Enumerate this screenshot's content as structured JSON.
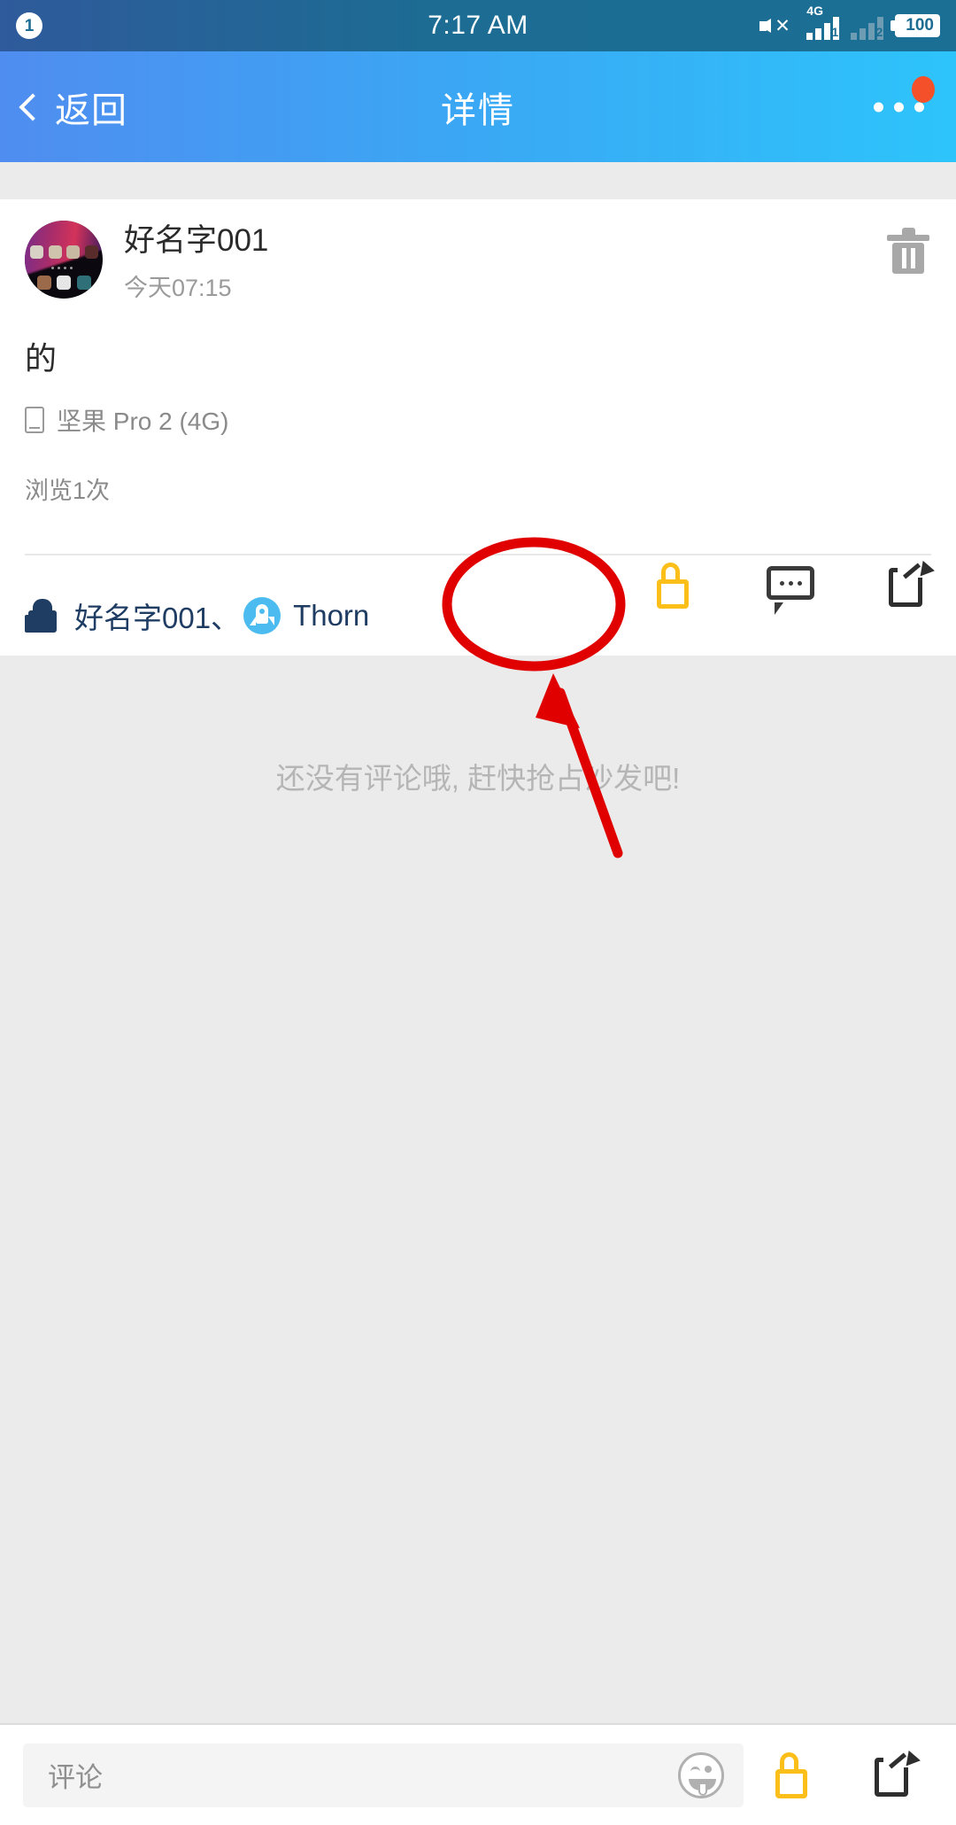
{
  "statusbar": {
    "notification_count": "1",
    "time": "7:17 AM",
    "mute_icon": "speaker-mute-icon",
    "network_label": "4G",
    "sim1_label": "1",
    "sim2_label": "2",
    "battery_level": "100"
  },
  "navbar": {
    "back_label": "返回",
    "title": "详情",
    "more_icon": "more-dots-icon",
    "has_badge": true,
    "badge_color": "#f4502a",
    "gradient_from": "#4f8df0",
    "gradient_to": "#2dc4fb"
  },
  "post": {
    "author": "好名字001",
    "time": "今天07:15",
    "content": "的",
    "device": "坚果 Pro 2 (4G)",
    "views": "浏览1次",
    "delete_icon": "trash-icon",
    "like_icon": "thumbs-up-icon",
    "comment_icon": "comment-bubble-icon",
    "share_icon": "share-icon",
    "like_icon_color": "#fcbe18"
  },
  "likes": {
    "icon": "thumbs-up-filled-icon",
    "first_user": "好名字001、",
    "second_user": "Thorn",
    "second_avatar_icon": "rocket-icon",
    "text_color": "#1f3c63",
    "avatar_color": "#4cbcf0"
  },
  "comments": {
    "empty_text": "还没有评论哦, 赶快抢占沙发吧!"
  },
  "bottombar": {
    "input_placeholder": "评论",
    "emoji_icon": "emoji-tongue-icon",
    "like_icon": "thumbs-up-icon",
    "share_icon": "share-icon"
  },
  "annotations": {
    "ellipse_color": "#e00000",
    "arrow_color": "#e00000"
  }
}
